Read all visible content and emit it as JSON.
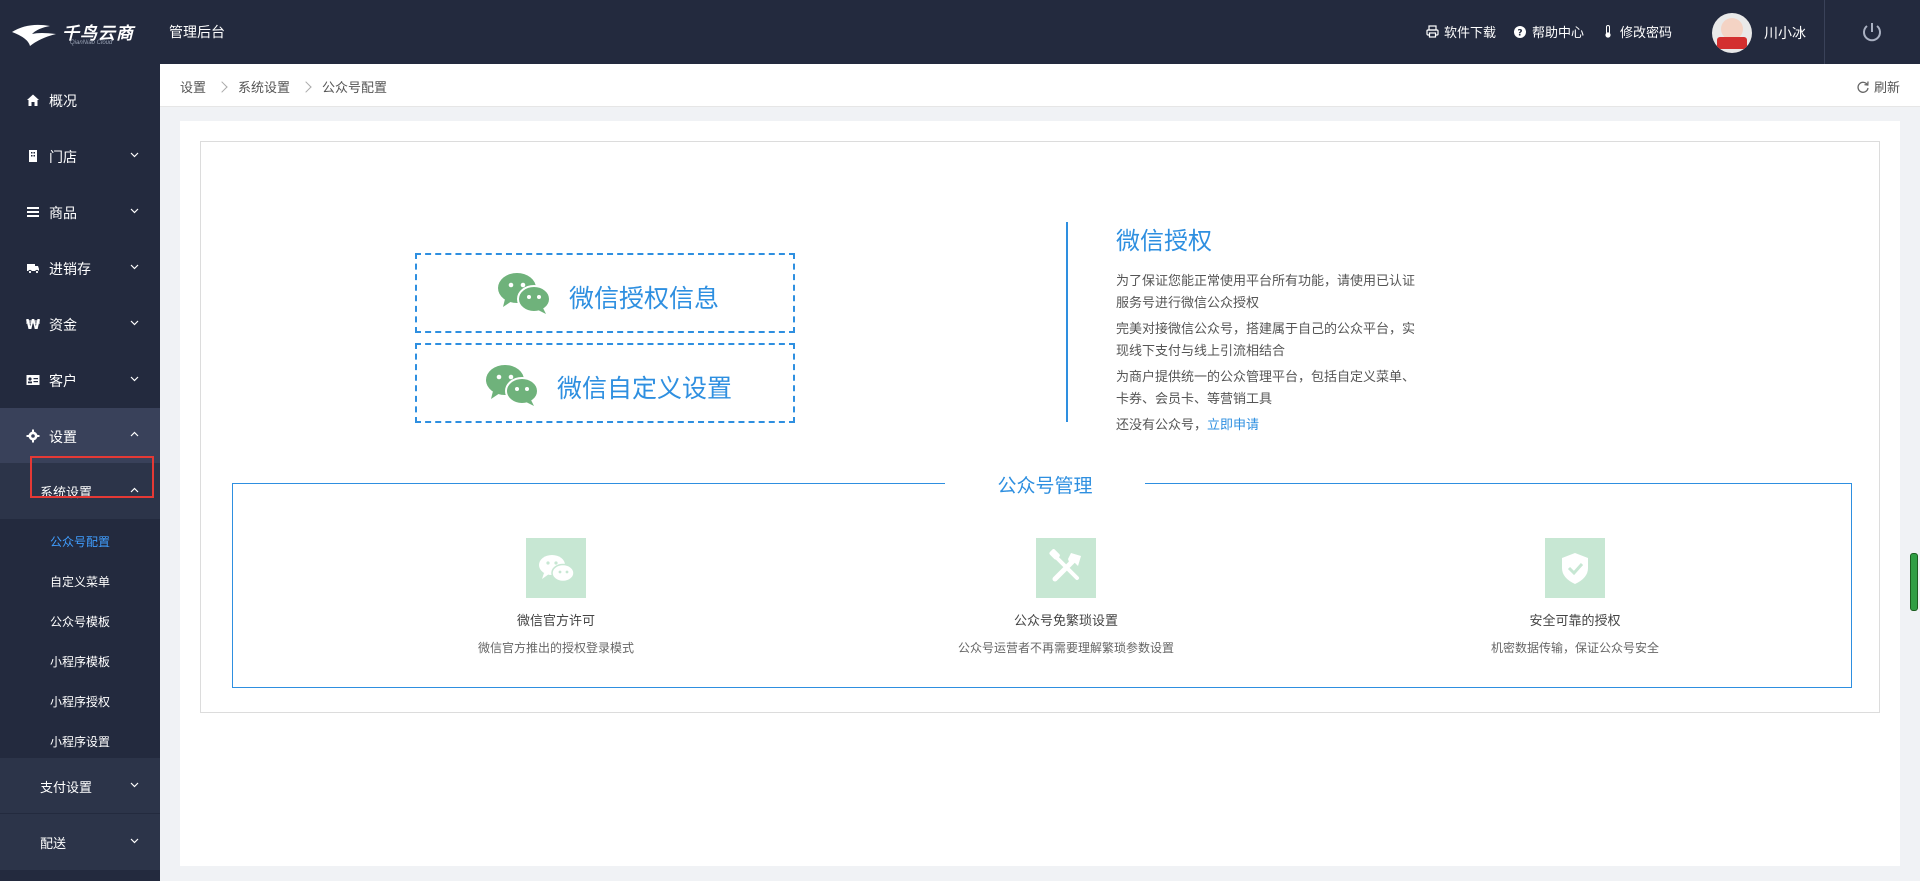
{
  "header": {
    "brand": "千鸟云商",
    "brand_sub": "QianNiao Cloud",
    "admin_title": "管理后台",
    "links": [
      {
        "label": "软件下载",
        "icon": "printer-icon"
      },
      {
        "label": "帮助中心",
        "icon": "help-circle-icon"
      },
      {
        "label": "修改密码",
        "icon": "thermometer-icon"
      }
    ],
    "user_name": "川小冰",
    "avatar_text": "川小冰"
  },
  "sidebar": {
    "items": [
      {
        "label": "概况",
        "icon": "home-icon"
      },
      {
        "label": "门店",
        "icon": "store-icon"
      },
      {
        "label": "商品",
        "icon": "list-icon"
      },
      {
        "label": "进销存",
        "icon": "truck-icon"
      },
      {
        "label": "资金",
        "icon": "won-icon"
      },
      {
        "label": "客户",
        "icon": "id-card-icon"
      },
      {
        "label": "设置",
        "icon": "gear-icon"
      }
    ],
    "system_settings": "系统设置",
    "sub_items": [
      "公众号配置",
      "自定义菜单",
      "公众号模板",
      "小程序模板",
      "小程序授权",
      "小程序设置"
    ],
    "pay_settings": "支付设置",
    "delivery": "配送"
  },
  "breadcrumb": [
    "设置",
    "系统设置",
    "公众号配置"
  ],
  "refresh_label": "刷新",
  "content": {
    "btn_auth_info": "微信授权信息",
    "btn_custom_settings": "微信自定义设置",
    "auth_title": "微信授权",
    "auth_p1": "为了保证您能正常使用平台所有功能，请使用已认证服务号进行微信公众授权",
    "auth_p2": "完美对接微信公众号，搭建属于自己的公众平台，实现线下支付与线上引流相结合",
    "auth_p3": "为商户提供统一的公众管理平台，包括自定义菜单、卡券、会员卡、等营销工具",
    "auth_p4_prefix": "还没有公众号，",
    "auth_apply": "立即申请",
    "mgmt_title": "公众号管理",
    "features": [
      {
        "title": "微信官方许可",
        "desc": "微信官方推出的授权登录模式",
        "icon": "wechat-icon"
      },
      {
        "title": "公众号免繁琐设置",
        "desc": "公众号运营者不再需要理解繁琐参数设置",
        "icon": "tools-icon"
      },
      {
        "title": "安全可靠的授权",
        "desc": "机密数据传输，保证公众号安全",
        "icon": "shield-check-icon"
      }
    ]
  },
  "colors": {
    "accent": "#2e8fe0",
    "sidebar_bg": "#232a3e",
    "feature_icon_bg": "#c7e7d3",
    "wechat_green": "#6fb27b"
  }
}
